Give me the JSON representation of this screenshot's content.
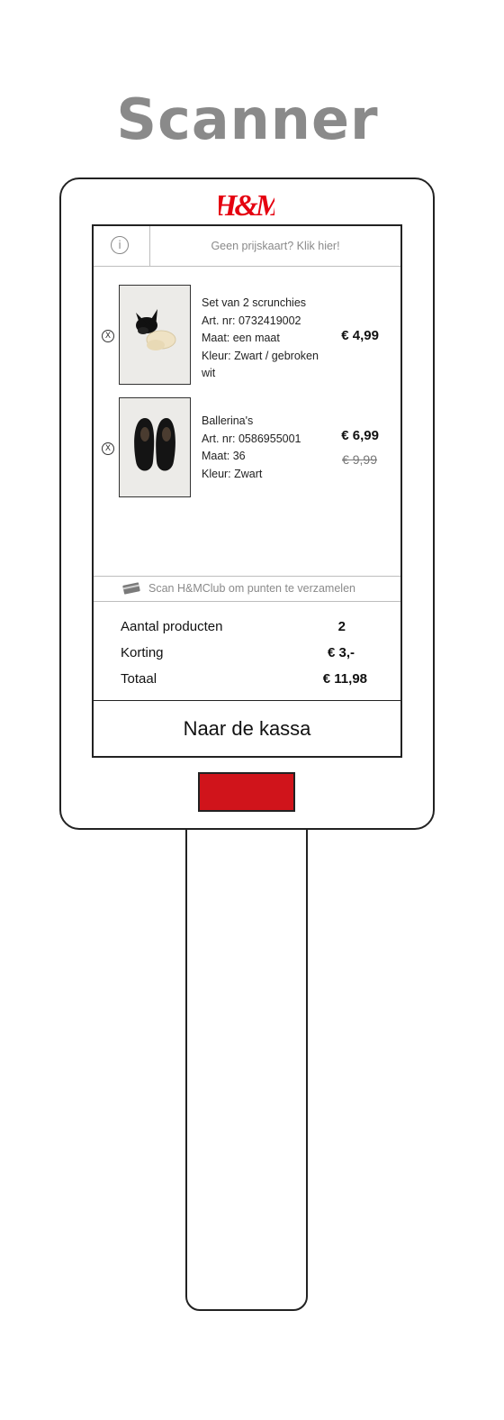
{
  "page_title": "Scanner",
  "brand": {
    "logo_text": "H&M",
    "color": "#e50010"
  },
  "info_bar": {
    "icon": "info-icon",
    "icon_glyph": "i",
    "price_link": "Geen prijskaart? Klik hier!"
  },
  "products": [
    {
      "remove_icon": "close-circle-icon",
      "remove_glyph": "X",
      "image": "scrunchies-photo",
      "name": "Set van 2 scrunchies",
      "article": "Art. nr: 0732419002",
      "size": "Maat: een maat",
      "color_line1": "Kleur: Zwart / gebroken",
      "color_line2": "wit",
      "price": "€ 4,99"
    },
    {
      "remove_icon": "close-circle-icon",
      "remove_glyph": "X",
      "image": "ballerinas-photo",
      "name": "Ballerina's",
      "article": "Art. nr: 0586955001",
      "size": "Maat: 36",
      "color_line1": "Kleur: Zwart",
      "price": "€ 6,99",
      "old_price": "€ 9,99"
    }
  ],
  "club_bar": {
    "icon": "card-icon",
    "text": "Scan H&MClub om punten te verzamelen"
  },
  "summary": {
    "count_label": "Aantal producten",
    "count_value": "2",
    "discount_label": "Korting",
    "discount_value": "€ 3,-",
    "total_label": "Totaal",
    "total_value": "€ 11,98"
  },
  "checkout_label": "Naar de kassa",
  "scanner_light_color": "#d0141b"
}
